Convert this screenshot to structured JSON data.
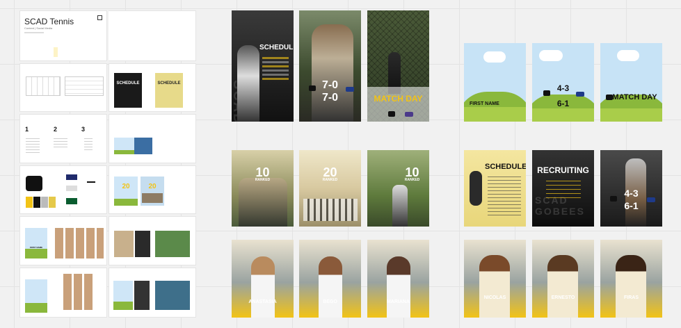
{
  "doc": {
    "title": "SCAD Tennis",
    "subtitle": "Content | Social Media"
  },
  "overview": {
    "steps": [
      {
        "num": "1",
        "label": ""
      },
      {
        "num": "2",
        "label": ""
      },
      {
        "num": "3",
        "label": ""
      }
    ]
  },
  "thumbs": {
    "schedule_a": "SCHEDULE",
    "schedule_b": "SCHEDULE",
    "ranked_a": "20",
    "ranked_b": "20",
    "name_card": "FIRST NAME"
  },
  "posters_row1": [
    {
      "id": "schedule",
      "title": "SCHEDULE",
      "ghost": "SCAD BEES"
    },
    {
      "id": "score",
      "score1": "7-0",
      "score2": "7-0"
    },
    {
      "id": "matchday",
      "title": "MATCH DAY"
    }
  ],
  "posters_row2": [
    {
      "id": "ranked-10",
      "number": "10",
      "label": "RANKED"
    },
    {
      "id": "ranked-20",
      "number": "20",
      "label": "RANKED"
    },
    {
      "id": "ranked-10b",
      "number": "10",
      "label": "RANKED"
    }
  ],
  "posters_row3": [
    {
      "id": "anastasia",
      "name": "ANASTASIA"
    },
    {
      "id": "bego",
      "name": "BEGO"
    },
    {
      "id": "mariana",
      "name": "MARIANA"
    }
  ],
  "right_row1": [
    {
      "id": "first-name",
      "title": "FIRST NAME"
    },
    {
      "id": "score-graphic",
      "score1": "4-3",
      "score2": "6-1"
    },
    {
      "id": "matchday-graphic",
      "title": "MATCH DAY"
    }
  ],
  "right_row2": [
    {
      "id": "schedule-yellow",
      "title": "SCHEDULE"
    },
    {
      "id": "recruiting",
      "title": "RECRUITING",
      "ghost": "SCAD GOBEES"
    },
    {
      "id": "score-photo",
      "score1": "4-3",
      "score2": "6-1"
    }
  ],
  "right_row3": [
    {
      "id": "nicolas",
      "name": "NICOLAS"
    },
    {
      "id": "ernesto",
      "name": "ERNESTO"
    },
    {
      "id": "firas",
      "name": "FIRAS"
    }
  ],
  "colors": {
    "gold": "#f2c316",
    "dark": "#111111",
    "sky": "#b9dcf5",
    "grass": "#8ab83c"
  }
}
